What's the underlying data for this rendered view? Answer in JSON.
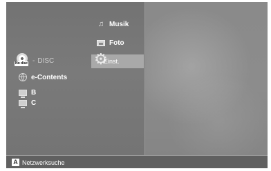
{
  "menu": {
    "disc": {
      "badge": "No disc",
      "label": "DISC",
      "bullet": "-"
    },
    "e_contents": {
      "label": "e-Contents",
      "icon": "globe-icon"
    },
    "devices": [
      {
        "label": "B",
        "icon": "monitor-icon"
      },
      {
        "label": "C",
        "icon": "monitor-icon"
      }
    ],
    "media": [
      {
        "label": "Musik",
        "icon": "music-note-icon"
      },
      {
        "label": "Foto",
        "icon": "photo-icon"
      },
      {
        "label": "Einst.",
        "icon": "gear-icon",
        "selected": true
      }
    ]
  },
  "bottom_bar": {
    "key": "A",
    "label": "Netzwerksuche"
  },
  "colors": {
    "selected_highlight": "#a9a9a9",
    "panel_bg": "#777777",
    "bottom_bar_bg": "#606060"
  }
}
